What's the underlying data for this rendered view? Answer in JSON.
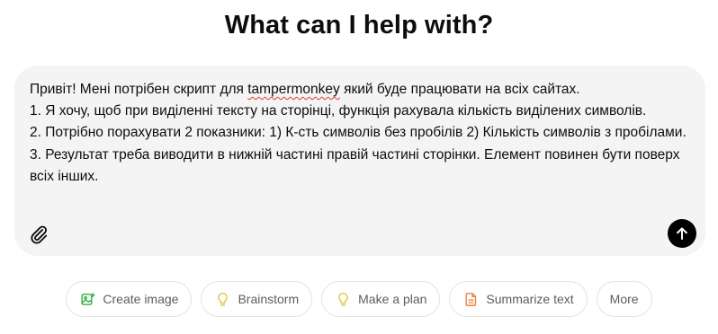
{
  "heading": "What can I help with?",
  "composer": {
    "lines": [
      {
        "before": "Привіт! Мені потрібен скрипт для ",
        "misspelled": "tampermonkey",
        "after": " який буде працювати на всіх сайтах."
      },
      "1. Я хочу, щоб при виділенні тексту на сторінці, функція рахувала кількість виділених символів.",
      "2. Потрібно порахувати 2 показники: 1) К-сть символів без пробілів 2) Кількість символів з пробілами.",
      "3. Результат треба виводити в нижній частині правій частині сторінки. Елемент повинен бути поверх всіх інших."
    ],
    "attach_icon": "paperclip-icon",
    "send_icon": "arrow-up-icon"
  },
  "suggestions": [
    {
      "label": "Create image",
      "icon": "image-icon",
      "color": "#35ae47"
    },
    {
      "label": "Brainstorm",
      "icon": "lightbulb-icon",
      "color": "#e2c541"
    },
    {
      "label": "Make a plan",
      "icon": "lightbulb-icon",
      "color": "#e2c541"
    },
    {
      "label": "Summarize text",
      "icon": "document-icon",
      "color": "#ea8444"
    },
    {
      "label": "More"
    }
  ]
}
